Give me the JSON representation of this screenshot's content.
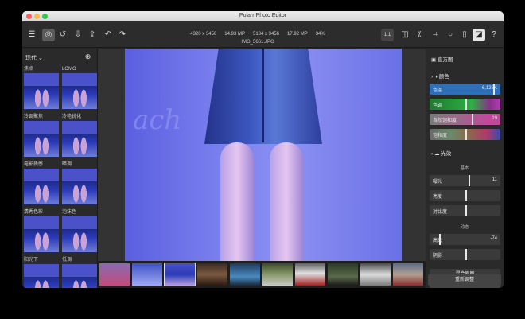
{
  "window": {
    "title": "Polarr Photo Editor"
  },
  "toolbar": {
    "resolution": "4320 x 3456",
    "megapixels": "14.93 MP",
    "original_resolution": "5184 x 3456",
    "original_megapixels": "17.92 MP",
    "zoom_percent": "34%",
    "filename": "IMG_5661.JPG",
    "zoom_button": "1:1"
  },
  "presets": {
    "header": "现代 ⌄",
    "items": [
      {
        "label": "焦点"
      },
      {
        "label": "LOMO"
      },
      {
        "label": "冷调聚焦"
      },
      {
        "label": "冷艳锐化"
      },
      {
        "label": "电影质感"
      },
      {
        "label": "暗调"
      },
      {
        "label": "清秀色彩"
      },
      {
        "label": "泡沫色"
      },
      {
        "label": "阳光下"
      },
      {
        "label": "低调"
      }
    ]
  },
  "right_panel": {
    "histogram": "直方图",
    "color_section": "颜色",
    "sliders_color": [
      {
        "label": "色温",
        "value": "6,125K",
        "fill": "#2f6fb8",
        "thumb": 0.9
      },
      {
        "label": "色调",
        "value": "",
        "fill": "linear",
        "thumb": 0.5
      },
      {
        "label": "自然饱和度",
        "value": "19",
        "fill": "vib",
        "thumb": 0.6
      },
      {
        "label": "饱和度",
        "value": "",
        "fill": "sat",
        "thumb": 0.5
      }
    ],
    "light_section": "光效",
    "basic_label": "基本",
    "sliders_basic": [
      {
        "label": "曝光",
        "value": "11",
        "thumb": 0.55
      },
      {
        "label": "亮度",
        "value": "",
        "thumb": 0.5
      },
      {
        "label": "对比度",
        "value": "",
        "thumb": 0.5
      }
    ],
    "dynamic_label": "动态",
    "sliders_dynamic": [
      {
        "label": "高光",
        "value": "-74",
        "thumb": 0.13
      },
      {
        "label": "阴影",
        "value": "",
        "thumb": 0.5
      }
    ],
    "blend_label": "混合原图",
    "reset_label": "重新调整"
  },
  "colors": {
    "accent_blue": "#2f6fb8"
  }
}
